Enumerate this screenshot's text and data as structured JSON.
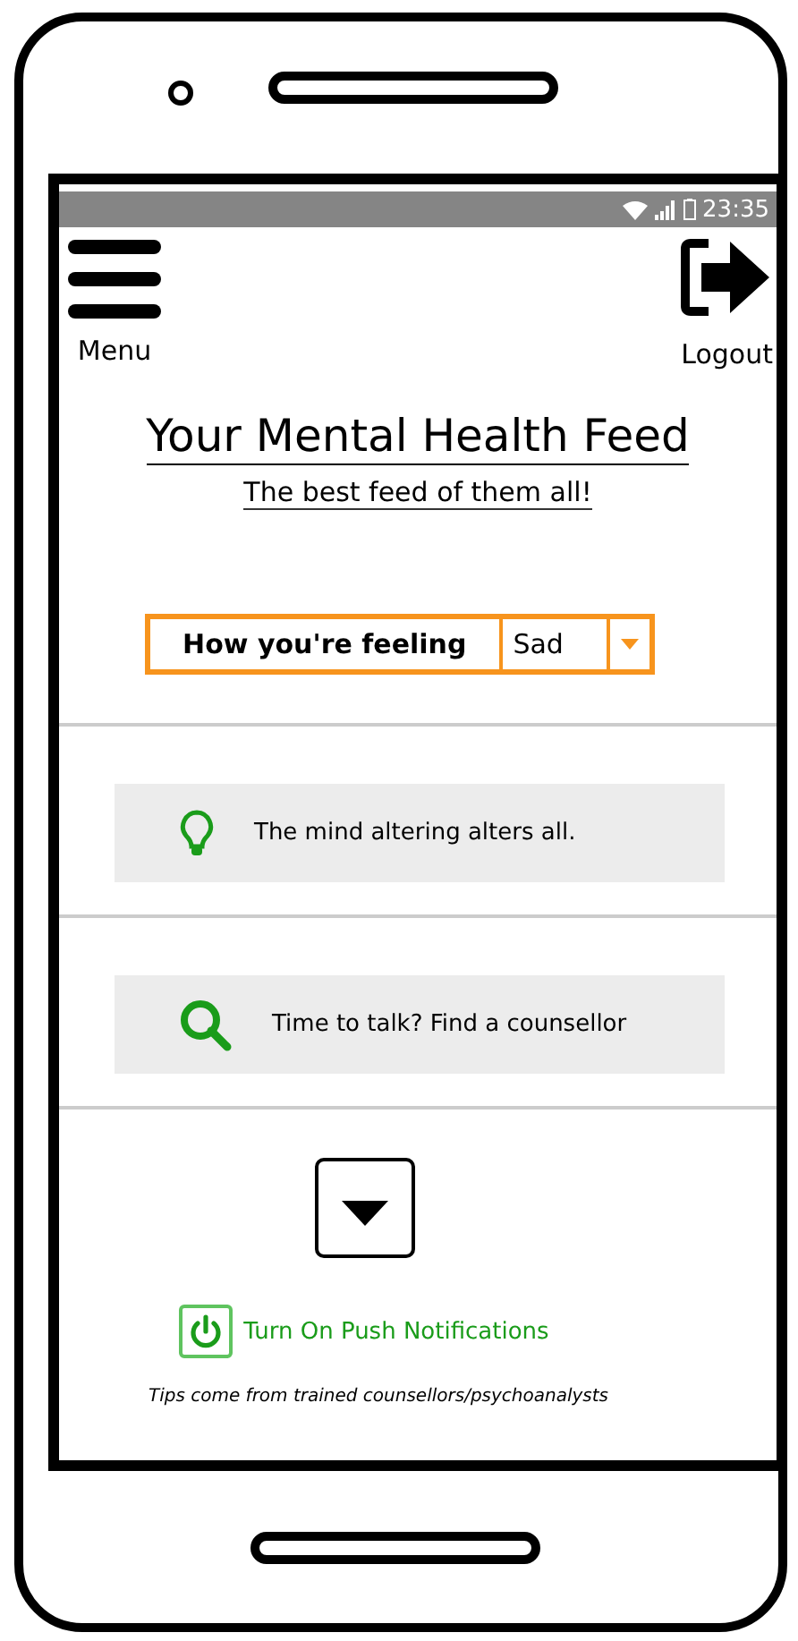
{
  "status_bar": {
    "time": "23:35"
  },
  "header": {
    "menu_label": "Menu",
    "logout_label": "Logout"
  },
  "title": "Your Mental Health Feed",
  "subtitle": "The best feed of them all!",
  "mood": {
    "label": "How you're feeling",
    "value": "Sad"
  },
  "feed": [
    {
      "kind": "tip",
      "text": "The mind altering alters all."
    },
    {
      "kind": "search",
      "text": "Time to talk? Find a counsellor"
    }
  ],
  "notifications_button": "Turn On Push Notifications",
  "footnote": "Tips come from trained counsellors/psychoanalysts"
}
